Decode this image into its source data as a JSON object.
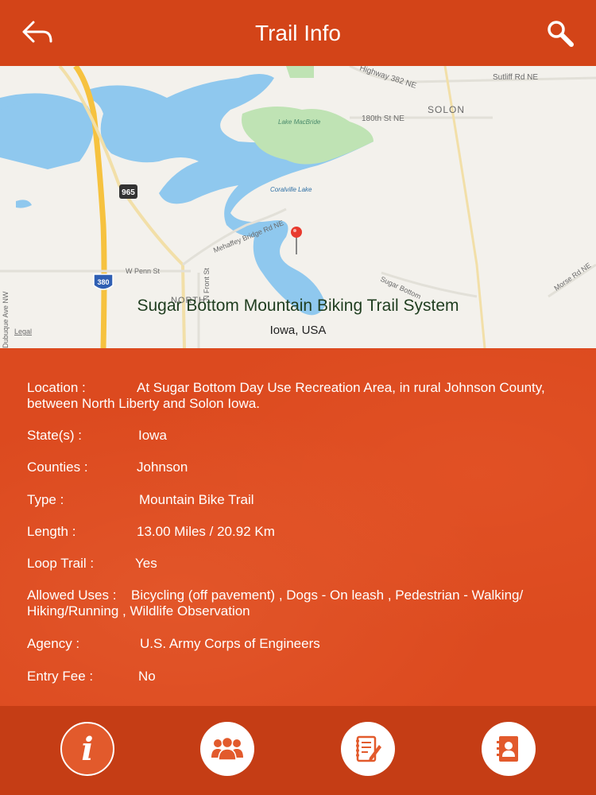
{
  "header": {
    "title": "Trail Info",
    "back_icon": "back-arrow-icon",
    "search_icon": "search-icon"
  },
  "map": {
    "trail_name": "Sugar Bottom Mountain Biking Trail System",
    "place": "Iowa, USA",
    "labels": {
      "highway_382": "Highway 382 NE",
      "sutliff": "Sutliff Rd NE",
      "solon": "SOLON",
      "st180": "180th St NE",
      "lake_macbride": "Lake MacBride",
      "coralville_lake": "Coralville Lake",
      "mehaffey": "Mehaffey Bridge Rd NE",
      "w_penn": "W Penn St",
      "front_st": "N Front St",
      "north": "NORTH",
      "sugar_bottom": "Sugar Bottom",
      "morse": "Morse Rd NE",
      "dubuque": "Dubuque Ave NW",
      "legal": "Legal",
      "i380": "380",
      "r965": "965"
    }
  },
  "info": [
    {
      "label": "Location  :",
      "value": "At Sugar Bottom Day Use Recreation Area, in rural Johnson County,",
      "value2": "between North Liberty and Solon Iowa."
    },
    {
      "label": "State(s)  :",
      "value": "Iowa"
    },
    {
      "label": "Counties  :",
      "value": "Johnson"
    },
    {
      "label": "Type  :",
      "value": "Mountain Bike Trail"
    },
    {
      "label": "Length  :",
      "value": "13.00 Miles / 20.92 Km"
    },
    {
      "label": "Loop Trail  :",
      "value": "Yes"
    },
    {
      "label": "Allowed Uses  :",
      "value": "Bicycling (off pavement) , Dogs - On leash , Pedestrian - Walking/",
      "value2": "Hiking/Running , Wildlife Observation"
    },
    {
      "label": "Agency  :",
      "value": "U.S. Army Corps of Engineers"
    },
    {
      "label": "Entry Fee  :",
      "value": "No"
    }
  ],
  "tabs": [
    {
      "icon": "info-icon",
      "active": true
    },
    {
      "icon": "users-group-icon",
      "active": false
    },
    {
      "icon": "notes-icon",
      "active": false
    },
    {
      "icon": "contact-book-icon",
      "active": false
    }
  ],
  "colors": {
    "header": "#d34418",
    "panel": "#dc4a1f",
    "bottom_bar": "#c53d15",
    "water": "#8fc8ee",
    "park": "#bfe3b4",
    "highway": "#f6c23f"
  }
}
